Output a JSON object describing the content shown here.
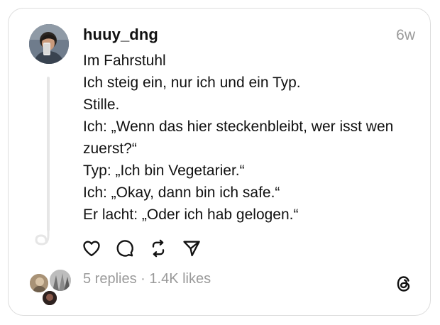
{
  "post": {
    "username": "huuy_dng",
    "time": "6w",
    "lines": [
      "Im Fahrstuhl",
      "Ich steig ein, nur ich und ein Typ.",
      "Stille.",
      "Ich: „Wenn das hier steckenbleibt, wer isst wen",
      "zuerst?“",
      "Typ: „Ich bin Vegetarier.“",
      "Ich: „Okay, dann bin ich safe.“",
      "Er lacht: „Oder ich hab gelogen.“"
    ]
  },
  "actions": {
    "like_icon": "heart-icon",
    "reply_icon": "comment-icon",
    "repost_icon": "repost-icon",
    "share_icon": "send-icon"
  },
  "stats": {
    "replies": "5 replies",
    "separator": " · ",
    "likes": "1.4K likes"
  },
  "colors": {
    "text": "#111111",
    "muted": "#9a9a9a",
    "border": "#dcdcdc",
    "thread_line": "#e6e6e6"
  }
}
